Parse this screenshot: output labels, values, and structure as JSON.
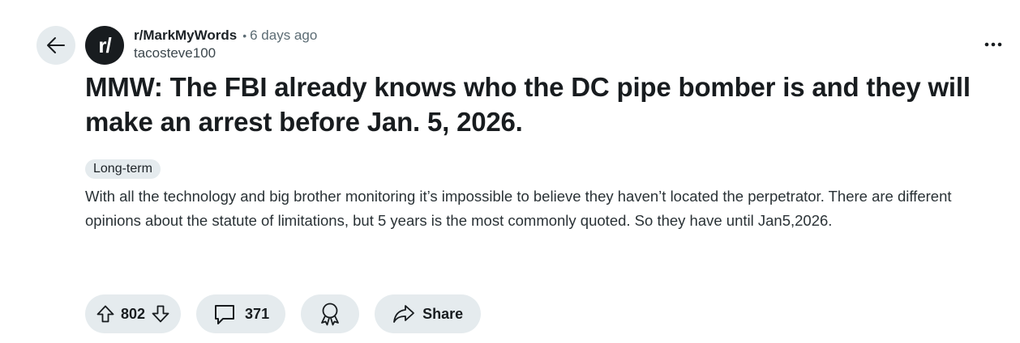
{
  "header": {
    "subreddit": "r/MarkMyWords",
    "separator": "•",
    "time": "6 days ago",
    "author": "tacosteve100",
    "avatar_text": "r/"
  },
  "post": {
    "title": "MMW: The FBI already knows who the DC pipe bomber is and they will make an arrest before Jan. 5, 2026.",
    "flair": "Long-term",
    "body": "With all the technology and big brother monitoring it’s impossible to believe they haven’t located the perpetrator. There are different opinions about the statute of limitations, but 5 years is the most commonly quoted. So they have until Jan5,2026."
  },
  "actions": {
    "votes": "802",
    "comments": "371",
    "share_label": "Share"
  },
  "icons": {
    "back": "arrow-left-icon",
    "more": "more-horizontal-icon",
    "upvote": "upvote-icon",
    "downvote": "downvote-icon",
    "comment": "comment-icon",
    "award": "award-icon",
    "share": "share-icon"
  },
  "colors": {
    "pill_bg": "#e5ebee",
    "text": "#181c1f",
    "muted": "#5c6c74"
  }
}
